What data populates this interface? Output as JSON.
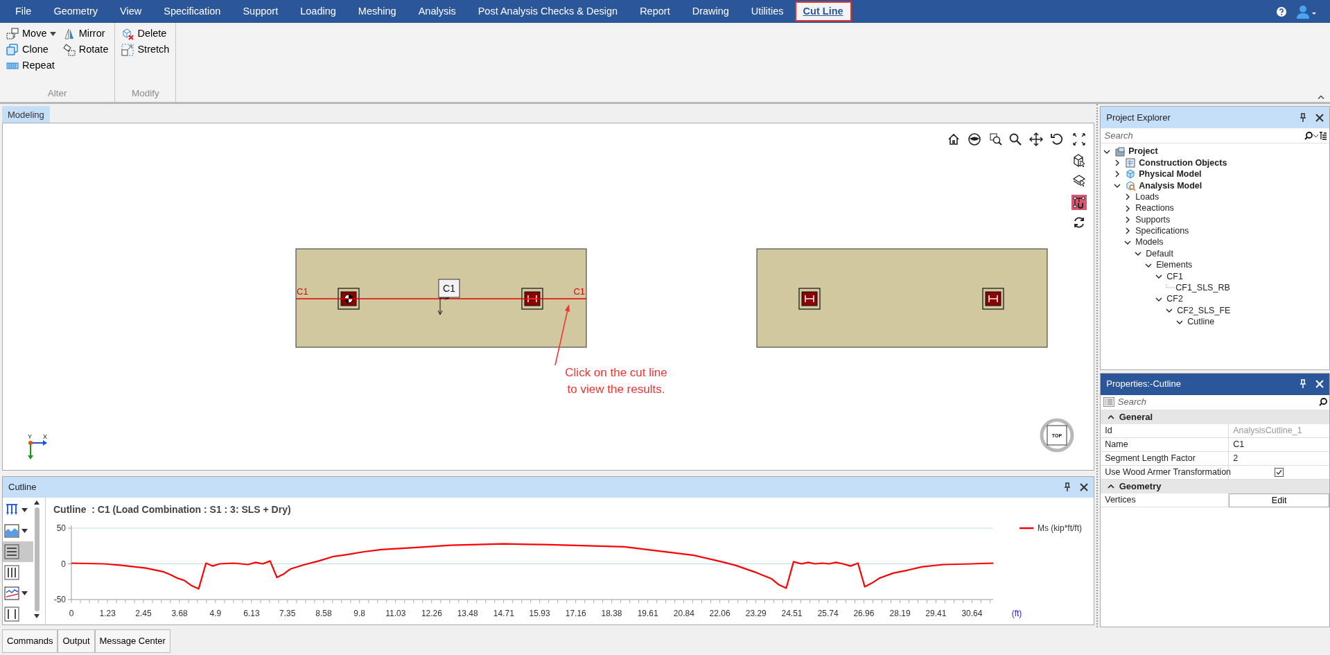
{
  "menu": [
    {
      "label": "File",
      "selected": false
    },
    {
      "label": "Geometry",
      "selected": false
    },
    {
      "label": "View",
      "selected": false
    },
    {
      "label": "Specification",
      "selected": false
    },
    {
      "label": "Support",
      "selected": false
    },
    {
      "label": "Loading",
      "selected": false
    },
    {
      "label": "Meshing",
      "selected": false
    },
    {
      "label": "Analysis",
      "selected": false
    },
    {
      "label": "Post Analysis Checks & Design",
      "selected": false
    },
    {
      "label": "Report",
      "selected": false
    },
    {
      "label": "Drawing",
      "selected": false
    },
    {
      "label": "Utilities",
      "selected": false
    },
    {
      "label": "Cut Line",
      "selected": true
    }
  ],
  "ribbon": {
    "groups": [
      {
        "label": "Alter",
        "columns": [
          [
            {
              "label": "Move",
              "dropdown": true
            },
            {
              "label": "Clone"
            },
            {
              "label": "Repeat"
            }
          ],
          [
            {
              "label": "Mirror"
            },
            {
              "label": "Rotate"
            }
          ]
        ]
      },
      {
        "label": "Modify",
        "columns": [
          [
            {
              "label": "Delete"
            },
            {
              "label": "Stretch"
            }
          ]
        ]
      }
    ]
  },
  "document_tabs": [
    {
      "label": "Modeling",
      "selected": true
    }
  ],
  "viewport": {
    "side_tools": [
      {
        "on": false
      },
      {
        "on": false
      },
      {
        "on": true
      },
      {
        "on": false
      }
    ],
    "slabs": [
      {
        "columns": [
          {
            "kind": "target"
          },
          {
            "kind": "plain"
          }
        ],
        "cut_line": {
          "start_label": "C1",
          "end_label": "C1",
          "tag": "C1"
        }
      },
      {
        "columns": [
          {
            "kind": "plain"
          },
          {
            "kind": "plain"
          }
        ]
      }
    ],
    "annotation": "Click on the cut line\nto view the results.",
    "axis_labels": [
      "Y",
      "X"
    ],
    "view_cube": "TOP"
  },
  "explorer": {
    "title": "Project Explorer",
    "search": {
      "placeholder": "Search"
    },
    "tree": [
      {
        "label": "Project",
        "expanded": true,
        "children": [
          {
            "label": "Construction Objects",
            "expanded": false
          },
          {
            "label": "Physical Model",
            "expanded": false
          },
          {
            "label": "Analysis Model",
            "expanded": true,
            "children": [
              {
                "label": "Loads",
                "expanded": false
              },
              {
                "label": "Reactions",
                "expanded": false
              },
              {
                "label": "Supports",
                "expanded": false
              },
              {
                "label": "Specifications",
                "expanded": false
              },
              {
                "label": "Models",
                "expanded": true,
                "children": [
                  {
                    "label": "Default",
                    "expanded": true,
                    "children": [
                      {
                        "label": "Elements",
                        "expanded": true,
                        "children": [
                          {
                            "label": "CF1",
                            "expanded": true,
                            "children": [
                              {
                                "label": "CF1_SLS_RB"
                              }
                            ]
                          },
                          {
                            "label": "CF2",
                            "expanded": true,
                            "children": [
                              {
                                "label": "CF2_SLS_FE",
                                "expanded": true,
                                "children": [
                                  {
                                    "label": "Cutline",
                                    "expanded": true
                                  }
                                ]
                              }
                            ]
                          }
                        ]
                      }
                    ]
                  }
                ]
              }
            ]
          }
        ]
      }
    ]
  },
  "properties": {
    "title": "Properties:-Cutline",
    "search": {
      "placeholder": "Search"
    },
    "sections": [
      {
        "title": "General",
        "expanded": true,
        "rows": [
          {
            "kind": "readonly",
            "name": "Id",
            "value": "AnalysisCutline_1"
          },
          {
            "kind": "text",
            "name": "Name",
            "value": "C1"
          },
          {
            "kind": "text",
            "name": "Segment Length Factor",
            "value": "2"
          },
          {
            "kind": "checkbox",
            "name": "Use Wood Armer Transformation",
            "checked": true
          }
        ]
      },
      {
        "title": "Geometry",
        "expanded": true,
        "rows": [
          {
            "kind": "button",
            "name": "Vertices",
            "value": "Edit"
          }
        ]
      }
    ]
  },
  "cutline_panel": {
    "title": "Cutline",
    "chart_tools": [
      {
        "selected": false,
        "dropdown": true
      },
      {
        "selected": false,
        "dropdown": true
      },
      {
        "selected": true,
        "dropdown": false
      },
      {
        "selected": false,
        "dropdown": false
      },
      {
        "selected": false,
        "dropdown": true
      },
      {
        "selected": false,
        "dropdown": false
      }
    ],
    "chart_data": {
      "type": "line",
      "title": "Cutline  : C1 (Load Combination : S1 : 3: SLS + Dry)",
      "xlabel": "(ft)",
      "x": [
        0,
        1.12,
        1.71,
        2.54,
        3.12,
        3.36,
        3.6,
        3.83,
        4.07,
        4.33,
        4.58,
        4.8,
        5.04,
        5.51,
        5.78,
        6.01,
        6.27,
        6.51,
        6.76,
        6.99,
        7.23,
        7.46,
        7.94,
        8.41,
        8.88,
        9.38,
        9.96,
        10.55,
        11.73,
        12.91,
        14.68,
        16.07,
        18.81,
        21.17,
        22.11,
        22.59,
        23.29,
        23.82,
        24.06,
        24.32,
        24.57,
        24.83,
        25.07,
        25.3,
        25.54,
        25.78,
        26.01,
        26.25,
        26.51,
        26.76,
        26.99,
        27.23,
        27.49,
        27.96,
        28.43,
        28.96,
        29.67,
        30.61,
        31.36
      ],
      "series": [
        {
          "name": "Ms (kip*ft/ft)",
          "color": "#ff0000",
          "values": [
            1,
            0,
            -2,
            -6,
            -11,
            -15,
            -20,
            -23,
            -30,
            -35,
            1,
            -3,
            0,
            1,
            0,
            -1,
            2,
            0,
            4,
            -19,
            -14,
            -7,
            -1,
            4,
            10,
            13,
            17,
            20,
            23,
            26,
            28,
            27,
            24,
            12,
            3,
            -2,
            -12,
            -21,
            -29,
            -34,
            3,
            0,
            2,
            0,
            1,
            0,
            2,
            0,
            -3,
            1,
            -32,
            -27,
            -20,
            -13,
            -9,
            -4,
            -1,
            0,
            1
          ]
        }
      ],
      "ref_lines": [
        {
          "axis": "y",
          "value": 0,
          "color": "#bcdcf5"
        }
      ],
      "xlim": [
        0,
        31.36
      ],
      "ylim": [
        -50,
        50
      ],
      "xticks": [
        0,
        1.23,
        2.45,
        3.68,
        4.9,
        6.13,
        7.35,
        8.58,
        9.8,
        11.03,
        12.26,
        13.48,
        14.71,
        15.93,
        17.16,
        18.38,
        19.61,
        20.84,
        22.06,
        23.29,
        24.51,
        25.74,
        26.96,
        28.19,
        29.41,
        30.64
      ],
      "yticks": [
        -50,
        0,
        50
      ]
    }
  },
  "bottom_tabs": [
    {
      "label": "Commands",
      "selected": false
    },
    {
      "label": "Output",
      "selected": false
    },
    {
      "label": "Message Center",
      "selected": false
    }
  ]
}
